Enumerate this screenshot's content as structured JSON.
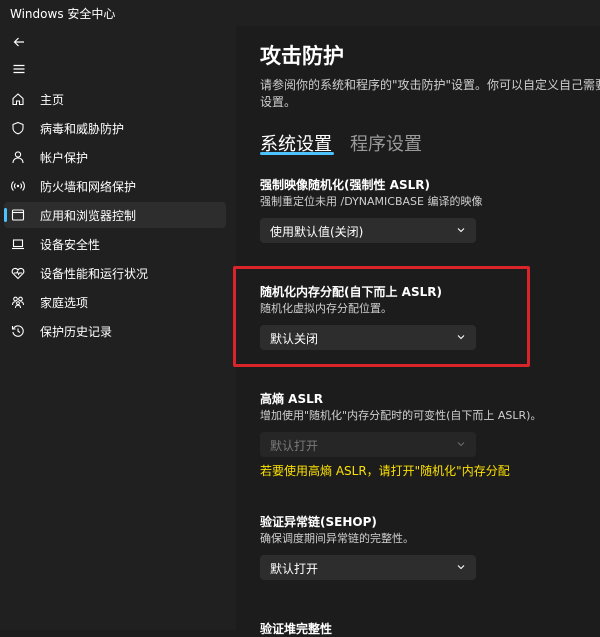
{
  "app": {
    "title": "Windows 安全中心"
  },
  "sidebar": {
    "items": [
      {
        "label": "主页",
        "icon": "home-icon"
      },
      {
        "label": "病毒和威胁防护",
        "icon": "shield-icon"
      },
      {
        "label": "帐户保护",
        "icon": "person-icon"
      },
      {
        "label": "防火墙和网络保护",
        "icon": "wireless-icon"
      },
      {
        "label": "应用和浏览器控制",
        "icon": "app-browser-icon",
        "selected": true
      },
      {
        "label": "设备安全性",
        "icon": "laptop-icon"
      },
      {
        "label": "设备性能和运行状况",
        "icon": "heart-pulse-icon"
      },
      {
        "label": "家庭选项",
        "icon": "family-icon"
      },
      {
        "label": "保护历史记录",
        "icon": "history-icon"
      }
    ]
  },
  "page": {
    "title": "攻击防护",
    "description": "请参阅你的系统和程序的\"攻击防护\"设置。你可以自定义自己需要的设置。"
  },
  "tabs": [
    {
      "label": "系统设置",
      "active": true
    },
    {
      "label": "程序设置",
      "active": false
    }
  ],
  "settings": {
    "forced_aslr": {
      "title": "强制映像随机化(强制性 ASLR)",
      "description": "强制重定位未用 /DYNAMICBASE 编译的映像",
      "value": "使用默认值(关闭)"
    },
    "bottom_up_aslr": {
      "title": "随机化内存分配(自下而上 ASLR)",
      "description": "随机化虚拟内存分配位置。",
      "value": "默认关闭"
    },
    "high_entropy_aslr": {
      "title": "高熵 ASLR",
      "description": "增加使用\"随机化\"内存分配时的可变性(自下而上 ASLR)。",
      "value": "默认打开",
      "disabled": true,
      "warning": "若要使用高熵 ASLR，请打开\"随机化\"内存分配"
    },
    "sehop": {
      "title": "验证异常链(SEHOP)",
      "description": "确保调度期间异常链的完整性。",
      "value": "默认打开"
    },
    "heap_integrity": {
      "title": "验证堆完整性"
    }
  },
  "colors": {
    "accent": "#4cc2ff",
    "highlight_border": "#d9252a",
    "warning": "#fce100"
  }
}
